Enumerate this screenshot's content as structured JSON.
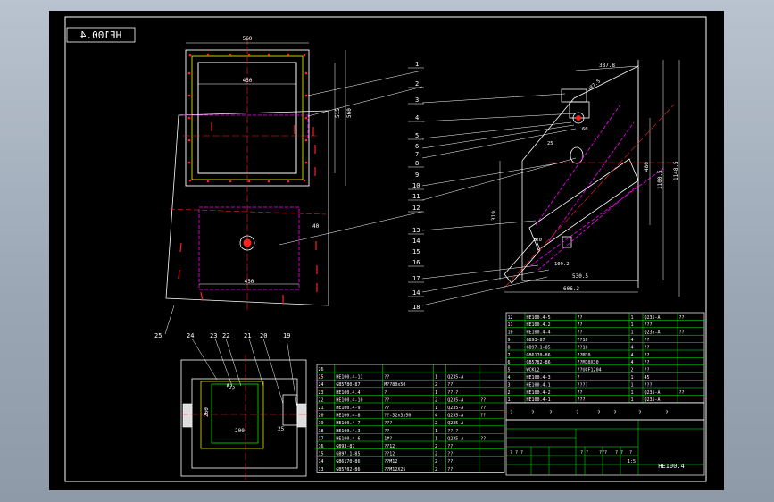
{
  "drawing": {
    "title_block_code": "HE100.4",
    "mirrored_label": "HE100.4",
    "colors": {
      "frame": "#ffffff",
      "green": "#00ff00",
      "magenta": "#ff00ff",
      "yellow": "#ffff00",
      "red": "#ff2020",
      "cyan": "#00ffff"
    },
    "front_view": {
      "dim_top": "560",
      "dim_inner": "450",
      "dim_bottom": "450",
      "dim_height_inner": "515",
      "dim_height_outer": "560",
      "dim_flange": "40"
    },
    "side_view": {
      "dim_top": "387.8",
      "dim_a": "187.5",
      "dim_b": "25",
      "dim_c": "60",
      "dim_bottom1": "530.5",
      "dim_bottom2": "606.2",
      "dim_small": "109.2",
      "dim_h1": "319",
      "dim_h2": "1100.5",
      "dim_h3": "1148.5",
      "dim_h4": "480",
      "dim_angle": "120"
    },
    "bottom_view": {
      "dim_diag": "Φ32",
      "dim_h": "260",
      "dim_w": "200",
      "dim_25": "25"
    },
    "callouts_right": [
      "1",
      "2",
      "3",
      "4",
      "5",
      "6",
      "7",
      "8",
      "9",
      "10",
      "11",
      "12",
      "13",
      "14",
      "15",
      "16",
      "17",
      "14",
      "18"
    ],
    "callouts_bottom": [
      "25",
      "24",
      "23",
      "22",
      "21",
      "20",
      "19"
    ],
    "bom_lower": [
      {
        "no": "26",
        "code": "",
        "name": "",
        "qty": "",
        "mat": "",
        "note": ""
      },
      {
        "no": "25",
        "code": "HE100.4-11",
        "name": "?? ",
        "qty": "1",
        "mat": "Q235-A",
        "note": ""
      },
      {
        "no": "24",
        "code": "GB5780-87",
        "name": "M??80x50",
        "qty": "2",
        "mat": "??",
        "note": ""
      },
      {
        "no": "23",
        "code": "HE100.4.4",
        "name": "?",
        "qty": "1",
        "mat": "??-?",
        "note": ""
      },
      {
        "no": "22",
        "code": "HE100.4-10",
        "name": "??",
        "qty": "2",
        "mat": "Q235-A",
        "note": "??"
      },
      {
        "no": "21",
        "code": "HE100.4-9",
        "name": "??",
        "qty": "1",
        "mat": "Q235-A",
        "note": "??"
      },
      {
        "no": "20",
        "code": "HE100.4-8",
        "name": "??-32x3x50",
        "qty": "4",
        "mat": "Q235-A",
        "note": "??"
      },
      {
        "no": "19",
        "code": "HE100.4-7",
        "name": "???",
        "qty": "2",
        "mat": "Q235-A",
        "note": ""
      },
      {
        "no": "18",
        "code": "HE100.4.3",
        "name": "??",
        "qty": "1",
        "mat": "??-?",
        "note": ""
      },
      {
        "no": "17",
        "code": "HE100.4-6",
        "name": "1#?",
        "qty": "1",
        "mat": "Q235-A",
        "note": "??"
      },
      {
        "no": "16",
        "code": "GB93-87",
        "name": "??12",
        "qty": "2",
        "mat": "??",
        "note": ""
      },
      {
        "no": "15",
        "code": "GB97.1-85",
        "name": "??12",
        "qty": "2",
        "mat": "??",
        "note": ""
      },
      {
        "no": "14",
        "code": "GB6170-86",
        "name": "??M12",
        "qty": "2",
        "mat": "??",
        "note": ""
      },
      {
        "no": "13",
        "code": "GB5782-86",
        "name": "??M12X25",
        "qty": "2",
        "mat": "??",
        "note": ""
      }
    ],
    "bom_upper": [
      {
        "no": "12",
        "code": "HE100.4-5",
        "name": "??",
        "qty": "1",
        "mat": "Q235-A",
        "note": "??"
      },
      {
        "no": "11",
        "code": "HE100.4.2",
        "name": "??",
        "qty": "1",
        "mat": "???",
        "note": ""
      },
      {
        "no": "10",
        "code": "HE100.4-4",
        "name": "??",
        "qty": "1",
        "mat": "Q235-A",
        "note": "??"
      },
      {
        "no": "9",
        "code": "GB93-87",
        "name": "??10",
        "qty": "4",
        "mat": "??",
        "note": ""
      },
      {
        "no": "8",
        "code": "GB97.1-85",
        "name": "??10",
        "qty": "4",
        "mat": "??",
        "note": ""
      },
      {
        "no": "7",
        "code": "GB6170-86",
        "name": "??M10",
        "qty": "4",
        "mat": "??",
        "note": ""
      },
      {
        "no": "6",
        "code": "GB5782-86",
        "name": "??M10X30",
        "qty": "4",
        "mat": "??",
        "note": ""
      },
      {
        "no": "5",
        "code": "WCKL2",
        "name": "??UCF1204",
        "qty": "2",
        "mat": "??",
        "note": ""
      },
      {
        "no": "4",
        "code": "HE100.4-3",
        "name": "?",
        "qty": "1",
        "mat": "45",
        "note": ""
      },
      {
        "no": "3",
        "code": "HE100.4.1",
        "name": "????",
        "qty": "1",
        "mat": "???",
        "note": ""
      },
      {
        "no": "2",
        "code": "HE100.4-2",
        "name": "??",
        "qty": "1",
        "mat": "Q235-A",
        "note": "??"
      },
      {
        "no": "1",
        "code": "HE100.4-1",
        "name": "???",
        "qty": "1",
        "mat": "Q235-A",
        "note": ""
      }
    ],
    "bom_header": [
      "?",
      "?",
      "?",
      "?",
      "?",
      "?",
      "?",
      "?"
    ],
    "title_block": {
      "code": "HE100.4",
      "scale_row": [
        "? ? ?",
        "? ?",
        "???",
        "? ?",
        "?"
      ],
      "ratio": "1:5"
    }
  }
}
